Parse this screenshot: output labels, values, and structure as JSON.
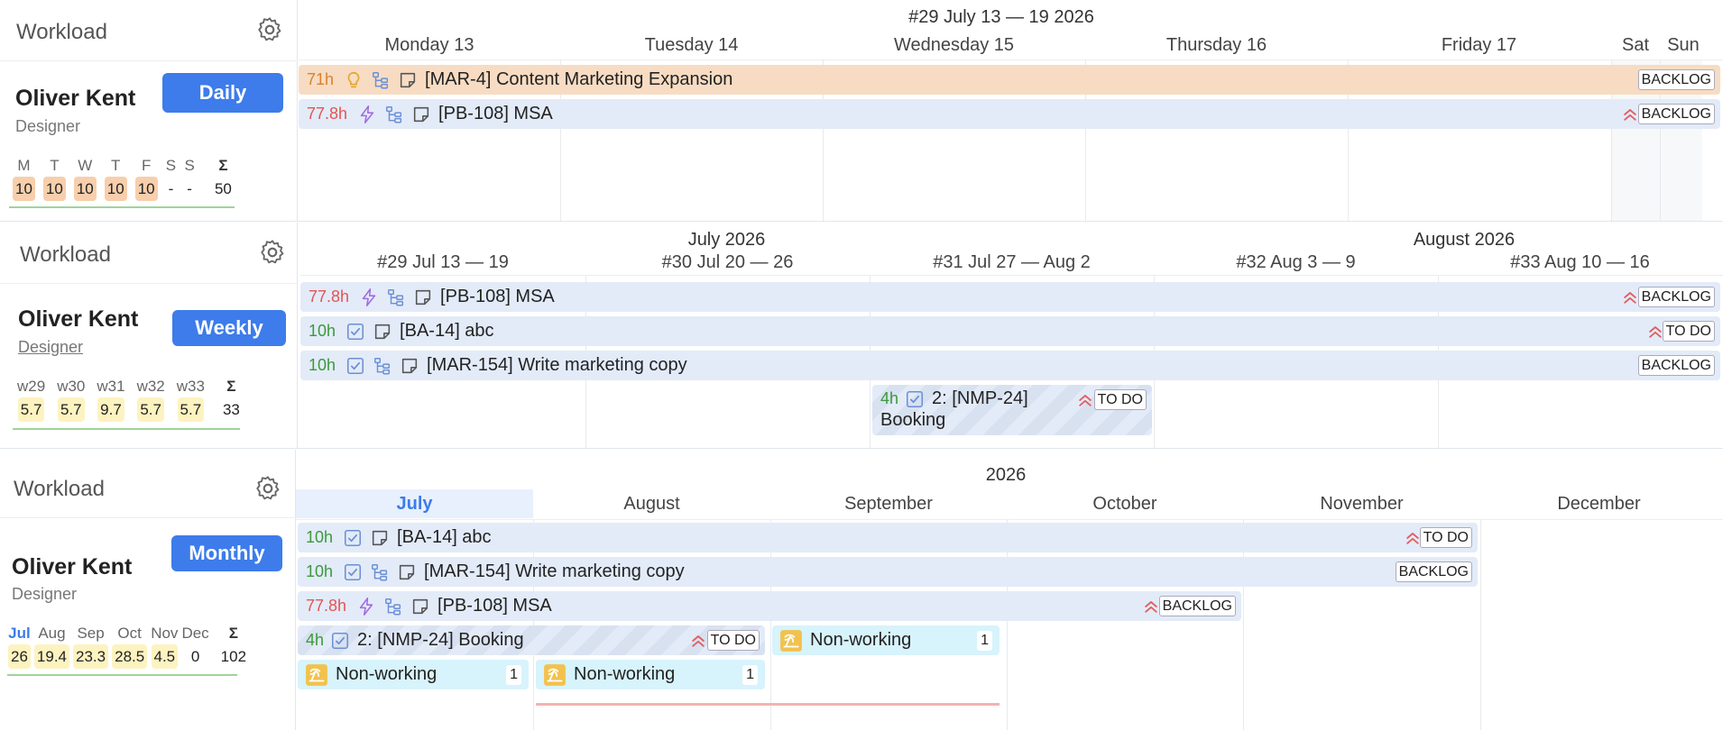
{
  "panels": [
    {
      "side_title": "Workload",
      "person": "Oliver Kent",
      "role": "Designer",
      "mode": "Daily",
      "summary_labels": [
        "M",
        "T",
        "W",
        "T",
        "F",
        "S",
        "S",
        "Σ"
      ],
      "summary_values": [
        "10",
        "10",
        "10",
        "10",
        "10",
        "-",
        "-",
        "50"
      ],
      "header_title": "#29 July 13 — 19 2026",
      "columns": [
        "Monday 13",
        "Tuesday 14",
        "Wednesday 15",
        "Thursday 16",
        "Friday 17",
        "Sat",
        "Sun"
      ],
      "tasks": [
        {
          "hours": "71h",
          "label": "[MAR-4] Content Marketing Expansion",
          "status": "BACKLOG"
        },
        {
          "hours": "77.8h",
          "label": "[PB-108] MSA",
          "status": "BACKLOG"
        }
      ]
    },
    {
      "side_title": "Workload",
      "person": "Oliver Kent",
      "role": "Designer",
      "mode": "Weekly",
      "summary_labels": [
        "w29",
        "w30",
        "w31",
        "w32",
        "w33",
        "Σ"
      ],
      "summary_values": [
        "5.7",
        "5.7",
        "9.7",
        "5.7",
        "5.7",
        "33"
      ],
      "months": [
        "July 2026",
        "August 2026"
      ],
      "columns": [
        "#29 Jul 13 — 19",
        "#30 Jul 20 — 26",
        "#31 Jul 27 — Aug 2",
        "#32 Aug 3 — 9",
        "#33 Aug 10 — 16"
      ],
      "tasks": [
        {
          "hours": "77.8h",
          "label": "[PB-108] MSA",
          "status": "BACKLOG"
        },
        {
          "hours": "10h",
          "label": "[BA-14] abc",
          "status": "TO DO"
        },
        {
          "hours": "10h",
          "label": "[MAR-154] Write marketing copy",
          "status": "BACKLOG"
        },
        {
          "hours": "4h",
          "label_line1": "2: [NMP-24]",
          "label_line2": "Booking",
          "status": "TO DO"
        }
      ]
    },
    {
      "side_title": "Workload",
      "person": "Oliver Kent",
      "role": "Designer",
      "mode": "Monthly",
      "summary_labels": [
        "Jul",
        "Aug",
        "Sep",
        "Oct",
        "Nov",
        "Dec",
        "Σ"
      ],
      "summary_values": [
        "26",
        "19.4",
        "23.3",
        "28.5",
        "4.5",
        "0",
        "102"
      ],
      "header_title": "2026",
      "columns": [
        "July",
        "August",
        "September",
        "October",
        "November",
        "December"
      ],
      "tasks": [
        {
          "hours": "10h",
          "label": "[BA-14] abc",
          "status": "TO DO"
        },
        {
          "hours": "10h",
          "label": "[MAR-154] Write marketing copy",
          "status": "BACKLOG"
        },
        {
          "hours": "77.8h",
          "label": "[PB-108] MSA",
          "status": "BACKLOG"
        },
        {
          "hours": "4h",
          "label": "2: [NMP-24] Booking",
          "status": "TO DO"
        }
      ],
      "nonworking": [
        {
          "label": "Non-working",
          "count": "1"
        },
        {
          "label": "Non-working",
          "count": "1"
        },
        {
          "label": "Non-working",
          "count": "1"
        }
      ]
    }
  ],
  "colors": {
    "accent": "#3d7cea",
    "task_blue": "#e3ebf8",
    "task_peach": "#f7dcc3",
    "nonworking": "#d7f3fb",
    "orange_value": "#f7cfac",
    "yellow_value": "#fdf3c0"
  }
}
